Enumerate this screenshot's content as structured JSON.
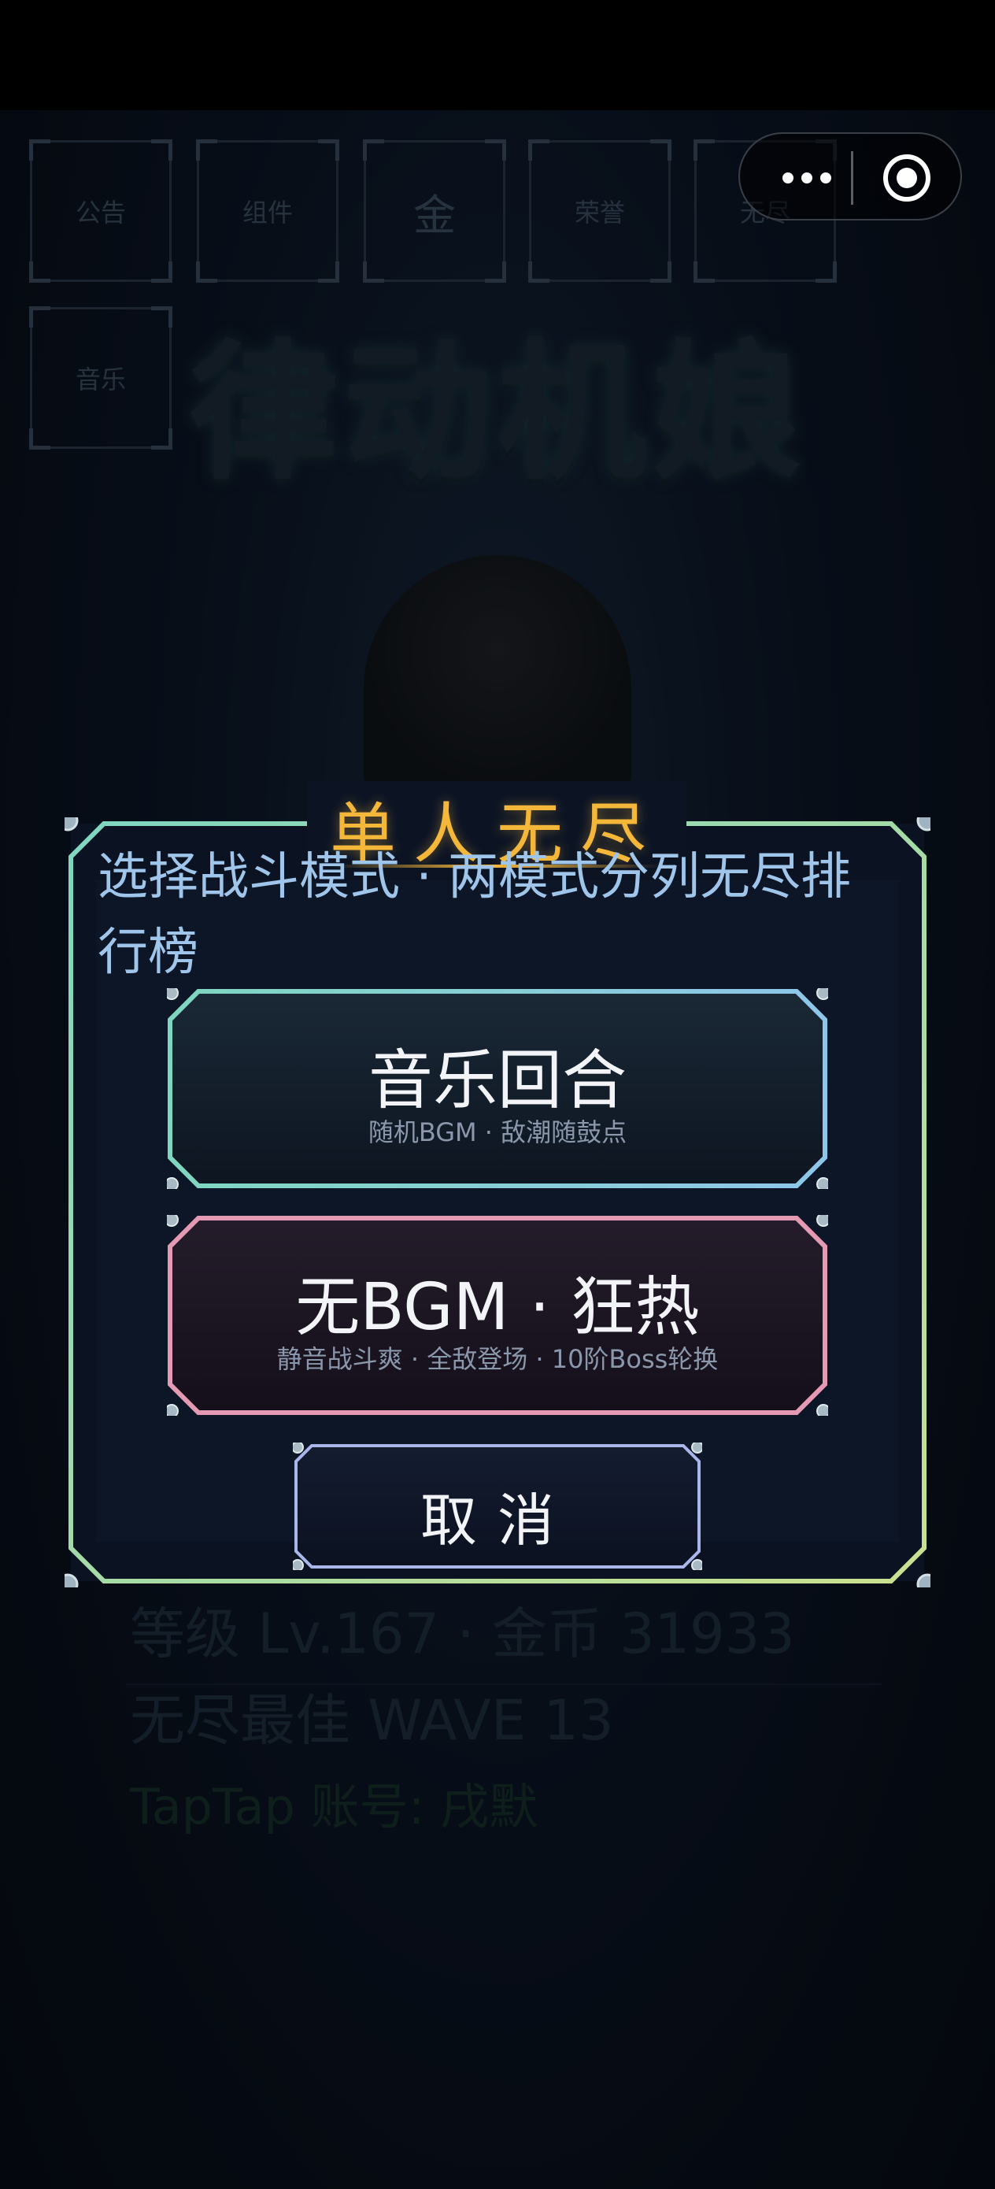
{
  "app": {
    "name": "律动机娘"
  },
  "top_tiles": [
    {
      "label": "公告"
    },
    {
      "label": "组件"
    },
    {
      "label": "金"
    },
    {
      "label": "荣誉"
    },
    {
      "label": "无尽"
    },
    {
      "label": "音乐"
    }
  ],
  "player": {
    "level_line": "等级 Lv.167 · 金币 31933",
    "best_line": "无尽最佳 WAVE 13",
    "account_line": "TapTap 账号: 戌默"
  },
  "modal": {
    "title": "单人无尽",
    "subtitle": "选择战斗模式 · 两模式分列无尽排行榜",
    "options": [
      {
        "label": "音乐回合",
        "desc": "随机BGM · 敌潮随鼓点",
        "accent": "#7fcfc8"
      },
      {
        "label": "无BGM · 狂热",
        "desc": "静音战斗爽 · 全敌登场 · 10阶Boss轮换",
        "accent": "#e59ab4"
      }
    ],
    "cancel_label": "取消",
    "frame_color_left": "#7fd6c0",
    "frame_color_right": "#c9e08e",
    "title_color": "#f5b73a"
  },
  "capsule": {
    "more_icon": "more-dots-icon",
    "close_icon": "close-miniprogram-icon"
  }
}
